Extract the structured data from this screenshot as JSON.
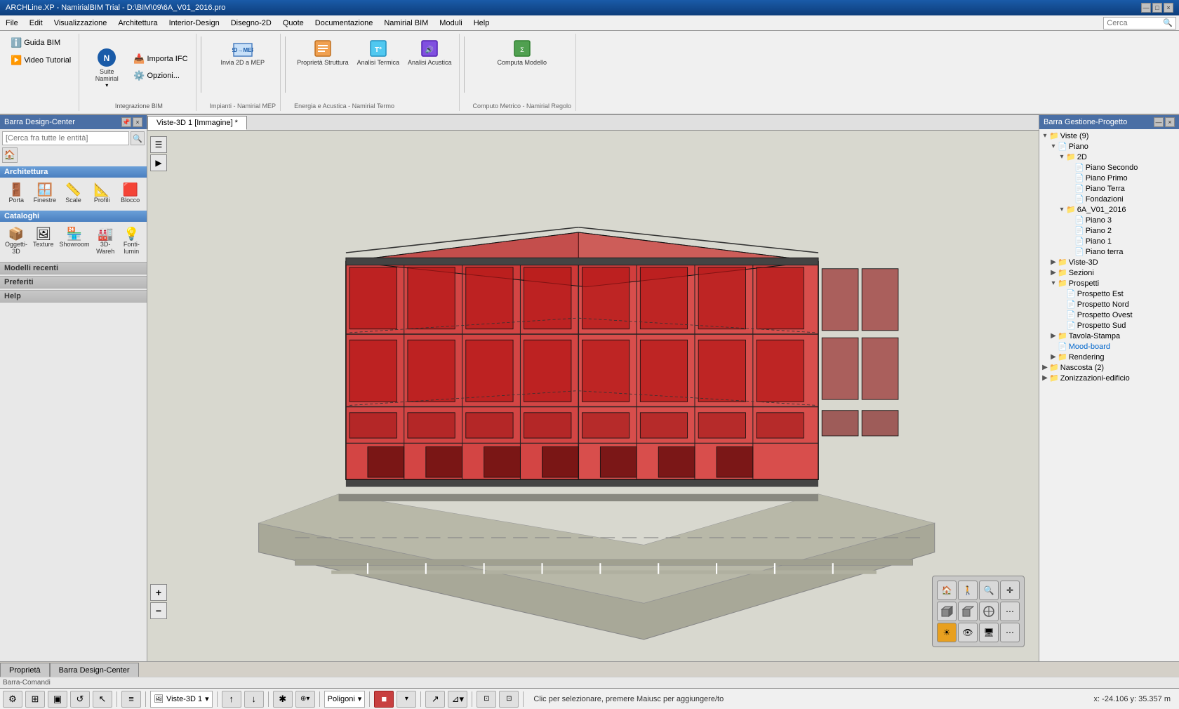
{
  "window": {
    "title": "ARCHLine.XP - NamirialBIM Trial - D:\\BIM\\09\\6A_V01_2016.pro",
    "controls": [
      "—",
      "□",
      "×"
    ]
  },
  "menubar": {
    "items": [
      "File",
      "Edit",
      "Visualizzazione",
      "Architettura",
      "Interior-Design",
      "Disegno-2D",
      "Quote",
      "Documentazione",
      "Namirial BIM",
      "Moduli",
      "Help"
    ],
    "search_placeholder": "Cerca"
  },
  "toolbar": {
    "guida_bim": "Guida BIM",
    "video_tutorial": "Video Tutorial",
    "suite_namirial": "Suite Namirial",
    "importa_ifc": "Importa IFC",
    "opzioni": "Opzioni...",
    "integrazione_bim_label": "Integrazione BIM",
    "invia_2d_mep": "Invia 2D a MEP",
    "impianti_namirial_label": "Impianti - Namirial MEP",
    "proprieta_struttura": "Proprietà Struttura",
    "analisi_termica": "Analisi Termica",
    "analisi_acustica": "Analisi Acustica",
    "energia_acustica_label": "Energia e Acustica - Namirial Termo",
    "computa_modello": "Computa Modello",
    "computo_metrico_label": "Computo Metrico - Namirial Regolo"
  },
  "left_panel": {
    "header": "Barra Design-Center",
    "search_placeholder": "[Cerca fra tutte le entità]",
    "architettura_label": "Architettura",
    "arch_items": [
      {
        "icon": "🚪",
        "label": "Porta"
      },
      {
        "icon": "🪟",
        "label": "Finestre"
      },
      {
        "icon": "📏",
        "label": "Scale"
      },
      {
        "icon": "📐",
        "label": "Profili"
      },
      {
        "icon": "🟥",
        "label": "Blocco"
      }
    ],
    "cataloghi_label": "Cataloghi",
    "cat_items": [
      {
        "icon": "📦",
        "label": "Oggetti-3D"
      },
      {
        "icon": "🖼",
        "label": "Texture"
      },
      {
        "icon": "🏪",
        "label": "Showroom"
      },
      {
        "icon": "🏭",
        "label": "3D-Wareh"
      },
      {
        "icon": "💡",
        "label": "Fonti-lumin"
      }
    ],
    "modelli_recenti": "Modelli recenti",
    "preferiti": "Preferiti",
    "help": "Help"
  },
  "canvas": {
    "tab_label": "Viste-3D 1 [Immagine] *"
  },
  "right_panel": {
    "header": "Barra Gestione-Progetto",
    "tree": [
      {
        "level": 0,
        "expand": "▾",
        "icon": "📁",
        "label": "Viste (9)"
      },
      {
        "level": 1,
        "expand": "▾",
        "icon": "📄",
        "label": "Piano"
      },
      {
        "level": 2,
        "expand": "▾",
        "icon": "📁",
        "label": "2D"
      },
      {
        "level": 3,
        "expand": " ",
        "icon": "📄",
        "label": "Piano Secondo"
      },
      {
        "level": 3,
        "expand": " ",
        "icon": "📄",
        "label": "Piano Primo"
      },
      {
        "level": 3,
        "expand": " ",
        "icon": "📄",
        "label": "Piano Terra"
      },
      {
        "level": 3,
        "expand": " ",
        "icon": "📄",
        "label": "Fondazioni"
      },
      {
        "level": 2,
        "expand": "▾",
        "icon": "📁",
        "label": "6A_V01_2016"
      },
      {
        "level": 3,
        "expand": " ",
        "icon": "📄",
        "label": "Piano 3"
      },
      {
        "level": 3,
        "expand": " ",
        "icon": "📄",
        "label": "Piano 2"
      },
      {
        "level": 3,
        "expand": " ",
        "icon": "📄",
        "label": "Piano 1"
      },
      {
        "level": 3,
        "expand": " ",
        "icon": "📄",
        "label": "Piano terra"
      },
      {
        "level": 1,
        "expand": "▶",
        "icon": "📁",
        "label": "Viste-3D"
      },
      {
        "level": 1,
        "expand": "▶",
        "icon": "📁",
        "label": "Sezioni"
      },
      {
        "level": 1,
        "expand": "▾",
        "icon": "📁",
        "label": "Prospetti"
      },
      {
        "level": 2,
        "expand": " ",
        "icon": "📄",
        "label": "Prospetto Est"
      },
      {
        "level": 2,
        "expand": " ",
        "icon": "📄",
        "label": "Prospetto Nord"
      },
      {
        "level": 2,
        "expand": " ",
        "icon": "📄",
        "label": "Prospetto Ovest"
      },
      {
        "level": 2,
        "expand": " ",
        "icon": "📄",
        "label": "Prospetto Sud"
      },
      {
        "level": 1,
        "expand": "▶",
        "icon": "📁",
        "label": "Tavola-Stampa"
      },
      {
        "level": 1,
        "expand": " ",
        "icon": "📄",
        "label": "Mood-board"
      },
      {
        "level": 1,
        "expand": "▶",
        "icon": "📁",
        "label": "Rendering"
      },
      {
        "level": 0,
        "expand": "▶",
        "icon": "📁",
        "label": "Nascosta (2)"
      },
      {
        "level": 0,
        "expand": "▶",
        "icon": "📁",
        "label": "Zonizzazioni-edificio"
      }
    ]
  },
  "bottom_tabs": [
    {
      "label": "Proprietà"
    },
    {
      "label": "Barra Design-Center"
    }
  ],
  "statusbar": {
    "barra_comandi": "Barra-Comandi",
    "view_label": "Viste-3D 1",
    "polygon_label": "Poligoni",
    "status_text": "Clic per selezionare, premere Maiusc per aggiungere/to",
    "coords": "x: -24.106   y: 35.357 m"
  },
  "nav_tools": {
    "house": "🏠",
    "walk": "🚶",
    "zoom": "🔍",
    "pan": "✛",
    "cube_iso": "⬜",
    "cube_left": "⬜",
    "cube_right": "⬜",
    "sun": "☀",
    "eye": "👁",
    "monitor": "🖥",
    "more": "⋯"
  },
  "colors": {
    "accent_blue": "#4a6fa5",
    "building_red": "#cc2222",
    "building_red_light": "rgba(204,50,50,0.7)",
    "bg_canvas": "#c8c8c0",
    "toolbar_bg": "#f0f0f0"
  }
}
